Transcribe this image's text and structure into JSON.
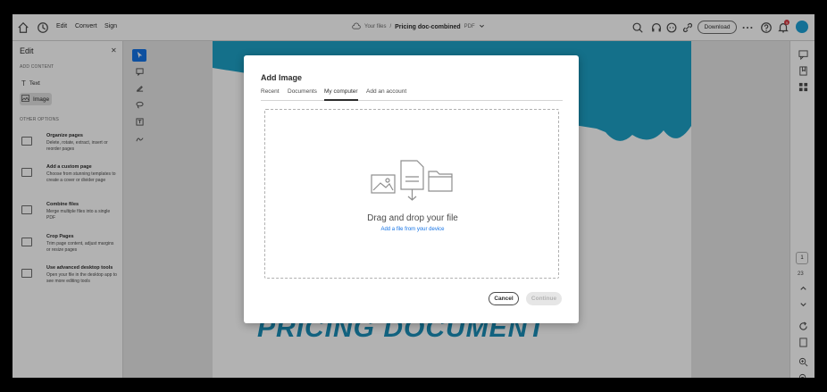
{
  "topbar": {
    "menus": [
      "Edit",
      "Convert",
      "Sign"
    ],
    "breadcrumb_root": "Your files",
    "breadcrumb_sep": "/",
    "file_name": "Pricing doc-combined",
    "file_type": "PDF",
    "download_label": "Download",
    "notification_count": "9"
  },
  "leftpanel": {
    "title": "Edit",
    "add_content_label": "ADD CONTENT",
    "tools": [
      {
        "label": "Text",
        "icon": "text-icon"
      },
      {
        "label": "Image",
        "icon": "image-icon"
      }
    ],
    "other_options_label": "OTHER OPTIONS",
    "options": [
      {
        "title": "Organize pages",
        "desc": "Delete, rotate, extract, insert or reorder pages"
      },
      {
        "title": "Add a custom page",
        "desc": "Choose from stunning templates to create a cover or divider page"
      },
      {
        "title": "Combine files",
        "desc": "Merge multiple files into a single PDF"
      },
      {
        "title": "Crop Pages",
        "desc": "Trim page content, adjust margins or resize pages"
      },
      {
        "title": "Use advanced desktop tools",
        "desc": "Open your file in the desktop app to see more editing tools"
      }
    ]
  },
  "document": {
    "title_text": "PRICING DOCUMENT",
    "accent_color": "#1da1c6"
  },
  "pagenav": {
    "current": "1",
    "total": "23"
  },
  "modal": {
    "title": "Add Image",
    "tabs": [
      "Recent",
      "Documents",
      "My computer",
      "Add an account"
    ],
    "active_tab": "My computer",
    "drop_text": "Drag and drop your file",
    "drop_link": "Add a file from your device",
    "cancel_label": "Cancel",
    "continue_label": "Continue"
  }
}
